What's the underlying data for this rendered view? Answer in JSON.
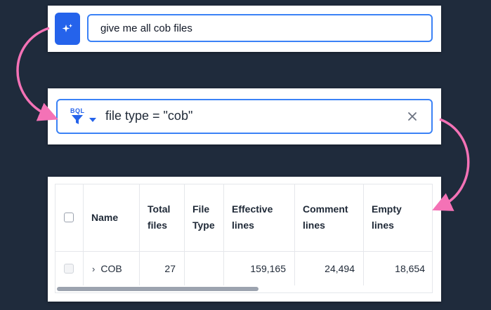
{
  "prompt": {
    "ai_icon": "sparkles-icon",
    "text": "give me all cob files"
  },
  "filter": {
    "badge": "BQL",
    "badge_icon": "funnel-icon",
    "dropdown_icon": "caret-down-icon",
    "query": "file type = \"cob\"",
    "clear_icon": "close-icon"
  },
  "table": {
    "columns": [
      {
        "line1": "Name",
        "line2": ""
      },
      {
        "line1": "Total",
        "line2": "files"
      },
      {
        "line1": "File",
        "line2": "Type"
      },
      {
        "line1": "Effective",
        "line2": "lines"
      },
      {
        "line1": "Comment",
        "line2": "lines"
      },
      {
        "line1": "Empty",
        "line2": "lines"
      }
    ],
    "rows": [
      {
        "name": "COB",
        "total_files": "27",
        "file_type": "",
        "effective_lines": "159,165",
        "comment_lines": "24,494",
        "empty_lines": "18,654"
      }
    ]
  },
  "colors": {
    "accent": "#2563eb",
    "arrow": "#f472b6",
    "background": "#1f2b3c"
  }
}
